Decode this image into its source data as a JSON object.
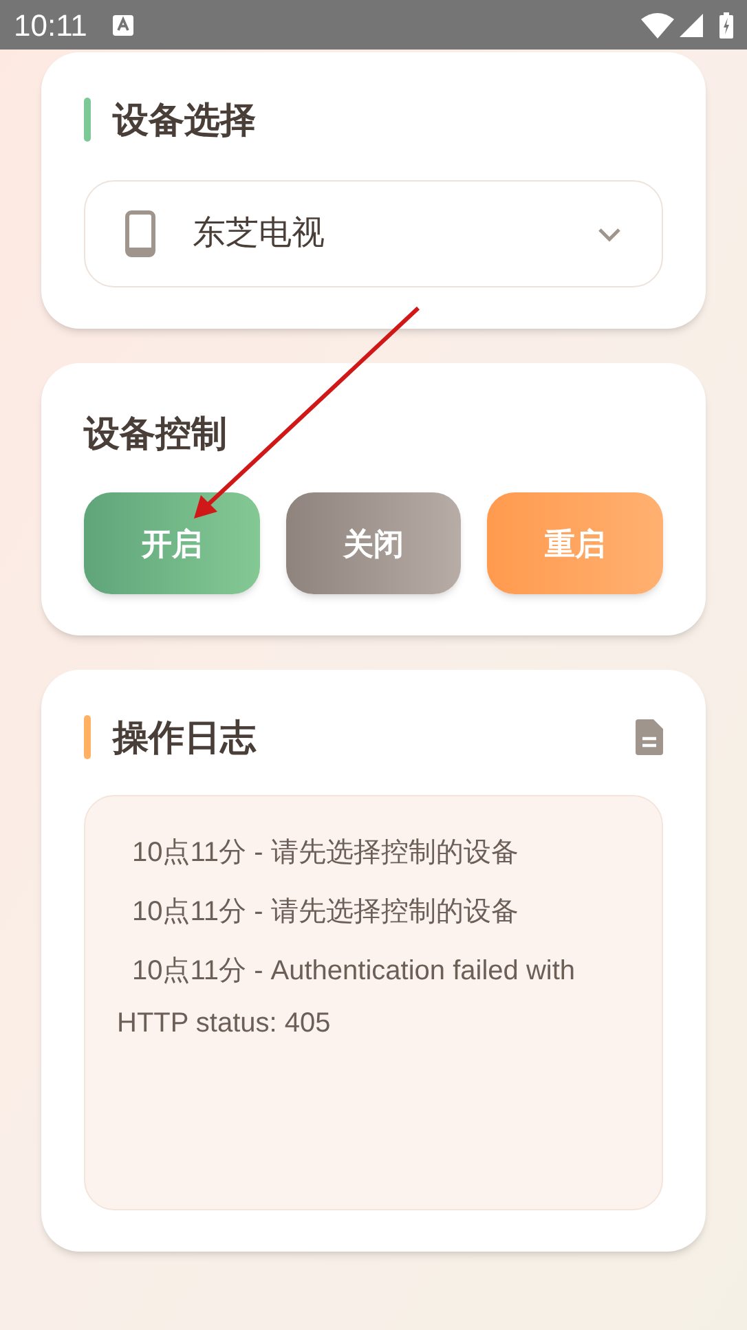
{
  "status_bar": {
    "time": "10:11"
  },
  "device_select": {
    "title": "设备选择",
    "value": "东芝电视"
  },
  "control": {
    "title": "设备控制",
    "buttons": [
      {
        "label": "开启",
        "kind": "on"
      },
      {
        "label": "关闭",
        "kind": "off"
      },
      {
        "label": "重启",
        "kind": "restart"
      }
    ]
  },
  "log": {
    "title": "操作日志",
    "entries": [
      "10点11分 - 请先选择控制的设备",
      "10点11分 - 请先选择控制的设备",
      "10点11分 - Authentication failed with HTTP status: 405"
    ]
  }
}
